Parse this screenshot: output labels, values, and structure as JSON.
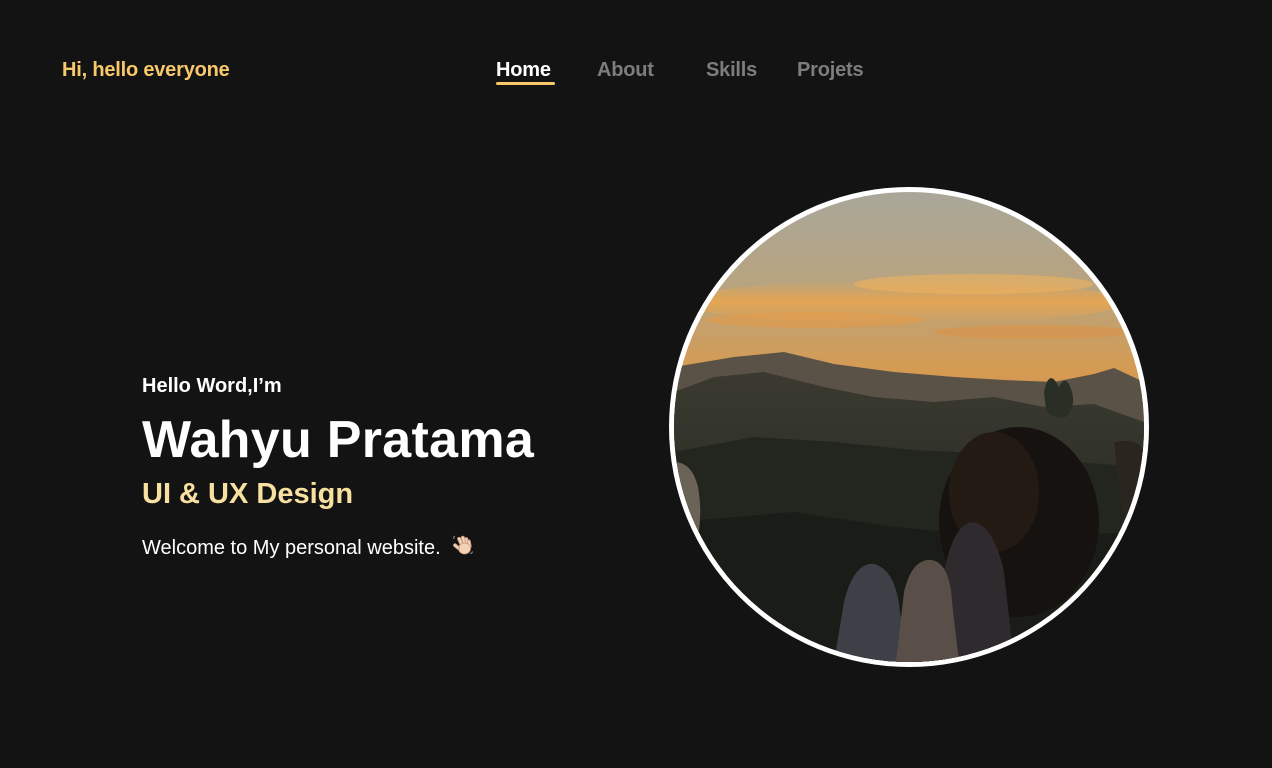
{
  "header": {
    "brand": "Hi, hello everyone",
    "nav": [
      {
        "label": "Home",
        "active": true
      },
      {
        "label": "About",
        "active": false
      },
      {
        "label": "Skills",
        "active": false
      },
      {
        "label": "Projets",
        "active": false
      }
    ]
  },
  "hero": {
    "greeting": "Hello Word,I’m",
    "name": "Wahyu Pratama",
    "role": "UI & UX Design",
    "welcome": "Welcome to My personal website.",
    "wave_icon": "waving-hand-icon"
  },
  "profile_photo": {
    "subject": "sunset-over-mountains-photo",
    "border_color": "#ffffff"
  },
  "colors": {
    "background": "#131313",
    "accent": "#F7C96A",
    "role_text": "#F7E0A0",
    "nav_inactive": "#7d7d7d"
  }
}
